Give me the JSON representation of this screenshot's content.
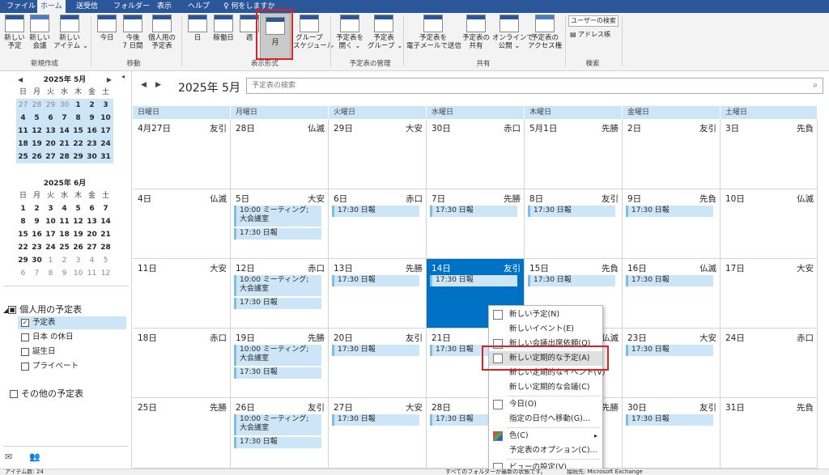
{
  "ribbon_tabs": [
    "ファイル",
    "ホーム",
    "送受信",
    "フォルダー",
    "表示",
    "ヘルプ"
  ],
  "tell_me": "何をしますか",
  "ribbon": {
    "new_appointment": "新しい\n予定",
    "new_meeting": "新しい\n会議",
    "new_items": "新しい\nアイテム ⌄",
    "group_new": "新規作成",
    "today": "今日",
    "next7": "今後\n7 日間",
    "personal_cal": "個人用の\n予定表",
    "group_move": "移動",
    "day": "日",
    "workweek": "稼働日",
    "week": "週",
    "month": "月",
    "schedule": "グループ\nスケジュール",
    "group_arrange": "表示形式",
    "open_cal": "予定表を\n開く ⌄",
    "cal_groups": "予定表\nグループ ⌄",
    "group_manage": "予定表の管理",
    "email_cal": "予定表を\n電子メールで送信",
    "share_cal": "予定表の\n共有",
    "publish": "オンラインで\n公開 ⌄",
    "permissions": "予定表の\nアクセス権",
    "group_share": "共有",
    "search_people": "ユーザーの検索",
    "address_book": "アドレス帳",
    "group_find": "検索"
  },
  "mini_may": {
    "title": "2025年 5月",
    "weekdays": [
      "日",
      "月",
      "火",
      "水",
      "木",
      "金",
      "土"
    ],
    "rows": [
      [
        "27",
        "28",
        "29",
        "30",
        "1",
        "2",
        "3"
      ],
      [
        "4",
        "5",
        "6",
        "7",
        "8",
        "9",
        "10"
      ],
      [
        "11",
        "12",
        "13",
        "14",
        "15",
        "16",
        "17"
      ],
      [
        "18",
        "19",
        "20",
        "21",
        "22",
        "23",
        "24"
      ],
      [
        "25",
        "26",
        "27",
        "28",
        "29",
        "30",
        "31"
      ]
    ]
  },
  "mini_jun": {
    "title": "2025年 6月",
    "weekdays": [
      "日",
      "月",
      "火",
      "水",
      "木",
      "金",
      "土"
    ],
    "rows": [
      [
        "1",
        "2",
        "3",
        "4",
        "5",
        "6",
        "7"
      ],
      [
        "8",
        "9",
        "10",
        "11",
        "12",
        "13",
        "14"
      ],
      [
        "15",
        "16",
        "17",
        "18",
        "19",
        "20",
        "21"
      ],
      [
        "22",
        "23",
        "24",
        "25",
        "26",
        "27",
        "28"
      ],
      [
        "29",
        "30",
        "1",
        "2",
        "3",
        "4",
        "5"
      ],
      [
        "6",
        "7",
        "8",
        "9",
        "10",
        "11",
        "12"
      ]
    ]
  },
  "folders": {
    "my_calendars": "個人用の予定表",
    "items": [
      "予定表",
      "日本 の休日",
      "誕生日",
      "プライベート"
    ],
    "other": "その他の予定表"
  },
  "main": {
    "title": "2025年 5月",
    "search_placeholder": "予定表の検索",
    "weekdays": [
      "日曜日",
      "月曜日",
      "火曜日",
      "水曜日",
      "木曜日",
      "金曜日",
      "土曜日"
    ],
    "weeks": [
      [
        {
          "d": "4月27日",
          "r": "友引",
          "a": []
        },
        {
          "d": "28日",
          "r": "仏滅",
          "a": []
        },
        {
          "d": "29日",
          "r": "大安",
          "a": []
        },
        {
          "d": "30日",
          "r": "赤口",
          "a": []
        },
        {
          "d": "5月1日",
          "r": "先勝",
          "a": []
        },
        {
          "d": "2日",
          "r": "友引",
          "a": []
        },
        {
          "d": "3日",
          "r": "先負",
          "a": []
        }
      ],
      [
        {
          "d": "4日",
          "r": "仏滅",
          "a": []
        },
        {
          "d": "5日",
          "r": "大安",
          "a": [
            "10:00 ミーティング; 大会議室",
            "17:30 日報"
          ]
        },
        {
          "d": "6日",
          "r": "赤口",
          "a": [
            "17:30 日報"
          ]
        },
        {
          "d": "7日",
          "r": "先勝",
          "a": [
            "17:30 日報"
          ]
        },
        {
          "d": "8日",
          "r": "友引",
          "a": [
            "17:30 日報"
          ]
        },
        {
          "d": "9日",
          "r": "先負",
          "a": [
            "17:30 日報"
          ]
        },
        {
          "d": "10日",
          "r": "仏滅",
          "a": []
        }
      ],
      [
        {
          "d": "11日",
          "r": "大安",
          "a": []
        },
        {
          "d": "12日",
          "r": "赤口",
          "a": [
            "10:00 ミーティング; 大会議室",
            "17:30 日報"
          ]
        },
        {
          "d": "13日",
          "r": "先勝",
          "a": [
            "17:30 日報"
          ]
        },
        {
          "d": "14日",
          "r": "友引",
          "a": [
            "17:30 日報"
          ]
        },
        {
          "d": "15日",
          "r": "先負",
          "a": [
            "17:30 日報"
          ]
        },
        {
          "d": "16日",
          "r": "仏滅",
          "a": [
            "17:30 日報"
          ]
        },
        {
          "d": "17日",
          "r": "大安",
          "a": []
        }
      ],
      [
        {
          "d": "18日",
          "r": "赤口",
          "a": []
        },
        {
          "d": "19日",
          "r": "先勝",
          "a": [
            "10:00 ミーティング; 大会議室",
            "17:30 日報"
          ]
        },
        {
          "d": "20日",
          "r": "友引",
          "a": [
            "17:30 日報"
          ]
        },
        {
          "d": "21日",
          "r": "",
          "a": [
            "17:30 日報"
          ]
        },
        {
          "d": "22日",
          "r": "仏滅",
          "a": []
        },
        {
          "d": "23日",
          "r": "大安",
          "a": [
            "17:30 日報"
          ]
        },
        {
          "d": "24日",
          "r": "赤口",
          "a": []
        }
      ],
      [
        {
          "d": "25日",
          "r": "先勝",
          "a": []
        },
        {
          "d": "26日",
          "r": "友引",
          "a": [
            "10:00 ミーティング; 大会議室",
            "17:30 日報"
          ]
        },
        {
          "d": "27日",
          "r": "大安",
          "a": [
            "17:30 日報"
          ]
        },
        {
          "d": "28日",
          "r": "",
          "a": [
            "17:30 日報"
          ]
        },
        {
          "d": "",
          "r": "先勝",
          "a": []
        },
        {
          "d": "30日",
          "r": "友引",
          "a": [
            "17:30 日報"
          ]
        },
        {
          "d": "31日",
          "r": "先負",
          "a": []
        }
      ]
    ]
  },
  "context_menu": [
    {
      "label": "新しい予定(N)",
      "icon": "calendar-icon"
    },
    {
      "label": "新しいイベント(E)",
      "icon": ""
    },
    {
      "label": "新しい会議出席依頼(Q)",
      "icon": "meeting-icon"
    },
    {
      "label": "新しい定期的な予定(A)",
      "icon": "recurring-icon"
    },
    {
      "label": "新しい定期的なイベント(V)",
      "icon": ""
    },
    {
      "label": "新しい定期的な会議(C)",
      "icon": ""
    },
    {
      "label": "今日(O)",
      "icon": "today-icon"
    },
    {
      "label": "指定の日付へ移動(G)...",
      "icon": ""
    },
    {
      "label": "色(C)",
      "icon": "color-icon"
    },
    {
      "label": "予定表のオプション(C)...",
      "icon": ""
    },
    {
      "label": "ビューの設定(V)...",
      "icon": "settings-icon"
    }
  ],
  "status": {
    "left": "アイテム数: 24",
    "center": "すべてのフォルダーが最新の状態です。",
    "right": "接続先: Microsoft Exchange"
  }
}
